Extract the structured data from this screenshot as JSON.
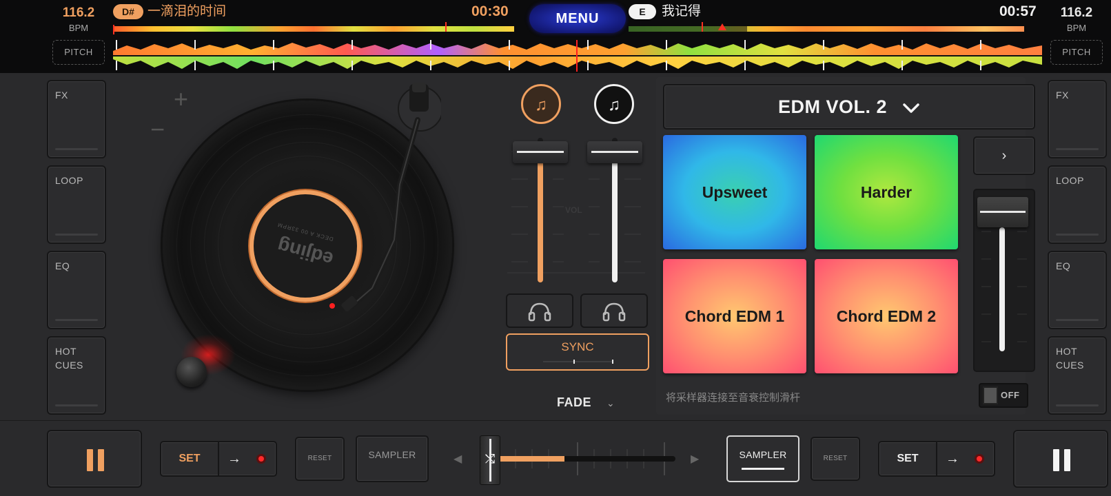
{
  "deck_left": {
    "bpm": "116.2",
    "bpm_label": "BPM",
    "pitch_label": "PITCH",
    "key": "D#",
    "track": "一滴泪的时间",
    "time": "00:30",
    "volume": 0.9,
    "accent": "#f0a060"
  },
  "deck_right": {
    "bpm": "116.2",
    "bpm_label": "BPM",
    "pitch_label": "PITCH",
    "key": "E",
    "track": "我记得",
    "time": "00:57",
    "volume": 0.9,
    "accent": "#f0f0f0"
  },
  "menu_label": "MENU",
  "side_buttons": {
    "fx": "FX",
    "loop": "LOOP",
    "eq": "EQ",
    "hot_cues": "HOT\nCUES"
  },
  "turntable": {
    "brand": "edjing",
    "label_small": "DECK A 00 33RPM",
    "zoom_in": "+",
    "zoom_out": "−"
  },
  "mixer": {
    "vol_label": "VOL",
    "sync_label": "SYNC",
    "fade_label": "FADE",
    "crossfader_position": 0.4
  },
  "sampler": {
    "pack_name": "EDM VOL. 2",
    "pads": [
      {
        "label": "Upsweet"
      },
      {
        "label": "Harder"
      },
      {
        "label": "Chord EDM 1"
      },
      {
        "label": "Chord EDM 2"
      }
    ],
    "next_label": "›",
    "fader_level": 1.0,
    "hint": "将采样器连接至音衰控制滑杆",
    "toggle_label": "OFF"
  },
  "bottom": {
    "left_set": "SET",
    "right_set": "SET",
    "reset": "RESET",
    "sampler": "SAMPLER"
  },
  "icons": {
    "music_note": "♫",
    "headphones": "headphones-icon",
    "pause": "pause-icon",
    "arrow": "→",
    "chevron_down": "⌄",
    "shuffle": "⤭",
    "triangle_left": "◀",
    "triangle_right": "▶"
  }
}
